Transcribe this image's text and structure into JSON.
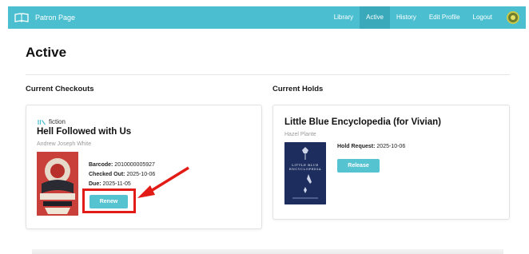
{
  "nav": {
    "brand": "Patron Page",
    "links": [
      "Library",
      "Active",
      "History",
      "Edit Profile",
      "Logout"
    ],
    "active_link": "Active",
    "brand_icon": "open-book-icon",
    "avatar": "user-avatar"
  },
  "page": {
    "title": "Active"
  },
  "checkouts": {
    "heading": "Current Checkouts",
    "item": {
      "genre": "fiction",
      "genre_icon": "library-shelf-icon",
      "title": "Hell Followed with Us",
      "author": "Andrew Joseph White",
      "barcode_label": "Barcode:",
      "barcode": "2010000005927",
      "checked_out_label": "Checked Out:",
      "checked_out": "2025-10-06",
      "due_label": "Due:",
      "due": "2025-11-05",
      "action": "Renew"
    }
  },
  "holds": {
    "heading": "Current Holds",
    "item": {
      "title": "Little Blue Encyclopedia (for Vivian)",
      "author": "Hazel Plante",
      "hold_label": "Hold Request:",
      "hold_date": "2025-10-06",
      "action": "Release",
      "cover_text": "LITTLE BLUE ENCYCLOPEDIA"
    }
  },
  "colors": {
    "nav": "#4bbfd0",
    "button": "#56c3d1",
    "annotation": "#e31b16"
  }
}
